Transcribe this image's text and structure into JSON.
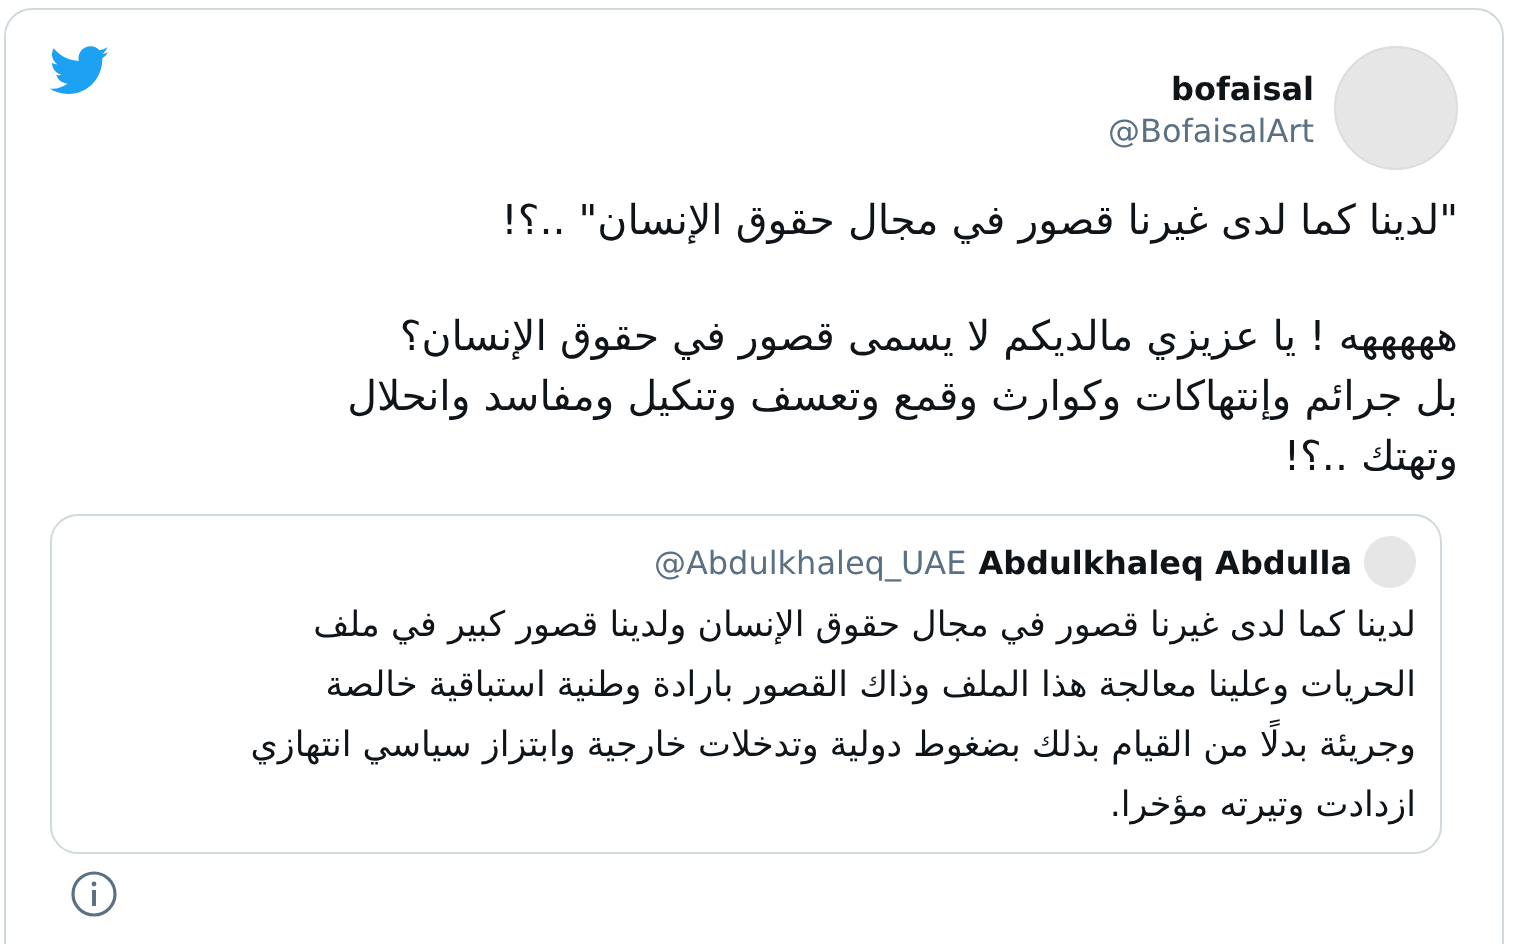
{
  "tweet": {
    "name": "bofaisal",
    "handle": "@BofaisalArt",
    "paragraphs": [
      "\"لدينا كما لدى غيرنا قصور في مجال حقوق الإنسان\" ..؟!",
      "هههههه ! يا عزيزي مالديكم لا يسمى قصور في حقوق الإنسان؟\nبل جرائم وإنتهاكات وكوارث وقمع وتعسف وتنكيل ومفاسد وانحلال\nوتهتك ..؟!"
    ],
    "quote": {
      "name": "Abdulkhaleq Abdulla",
      "handle": "@Abdulkhaleq_UAE",
      "text": "لدينا كما لدى غيرنا قصور في مجال حقوق الإنسان ولدينا قصور كبير في ملف\nالحريات وعلينا معالجة هذا الملف وذاك القصور بارادة وطنية استباقية خالصة\nوجريئة بدلًا من القيام بذلك بضغوط دولية وتدخلات خارجية وابتزاز سياسي انتهازي\nازدادت وتيرته مؤخرا."
    }
  }
}
